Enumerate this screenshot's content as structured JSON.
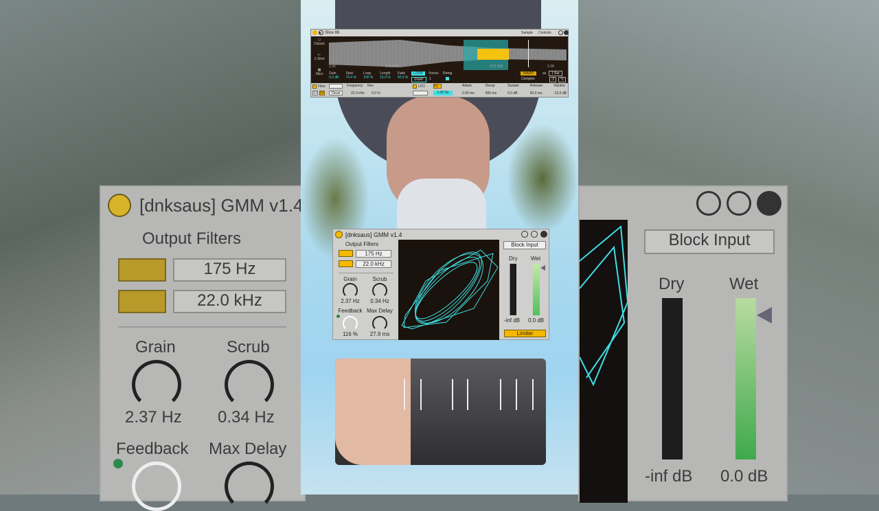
{
  "sampler": {
    "title": "Slice 86",
    "tabs": [
      "Sample",
      "Controls"
    ],
    "modes": [
      "Classic",
      "1-Shot",
      "Slice"
    ],
    "time_labels": [
      "2:36",
      "2:36.500",
      "2:37",
      "2:37.500",
      "2:38"
    ],
    "params": [
      {
        "label": "Gain",
        "value": "0.0 dB"
      },
      {
        "label": "Start",
        "value": "74.4 %"
      },
      {
        "label": "Loop",
        "value": "100 %"
      },
      {
        "label": "Length",
        "value": "15.9 %"
      },
      {
        "label": "Fade",
        "value": "50.0 %"
      }
    ],
    "loop_label": "LOOP",
    "snap_label": "SNAP",
    "voices_label": "Voices",
    "voices_value": "1",
    "retrig_label": "Retrig",
    "warp_label": "WARP",
    "as_label": "as",
    "bar_value": "1 Bar",
    "warp_mode": "Complex",
    "half_label": ":2",
    "double_label": "*2",
    "filter_label": "Filter",
    "filter_type": "",
    "filter_12": "12",
    "filter_24": "24",
    "filter_circuit": "Clean",
    "frequency_label": "Frequency",
    "frequency_value": "22.0 kHz",
    "res_label": "Res",
    "res_value": "0.0 %",
    "lfo_label": "LFO",
    "lfo_hz": "Hz",
    "lfo_rate": "1.00 Hz",
    "envelope": [
      {
        "label": "Attack",
        "value": "0.00 ms"
      },
      {
        "label": "Decay",
        "value": "600 ms"
      },
      {
        "label": "Sustain",
        "value": "0.0 dB"
      },
      {
        "label": "Release",
        "value": "50.0 ms"
      },
      {
        "label": "Volume",
        "value": "-12.0 dB"
      }
    ]
  },
  "gmm": {
    "title": "[dnksaus] GMM v1.4",
    "output_filters": "Output Filters",
    "hp_value": "175 Hz",
    "lp_value": "22.0 kHz",
    "grain_label": "Grain",
    "grain_value": "2.37 Hz",
    "scrub_label": "Scrub",
    "scrub_value": "0.34 Hz",
    "feedback_label": "Feedback",
    "feedback_value": "116 %",
    "max_delay_label": "Max Delay",
    "max_delay_value": "27.9 ms",
    "block_input": "Block Input",
    "dry_label": "Dry",
    "dry_value": "-inf dB",
    "wet_label": "Wet",
    "wet_value": "0.0 dB",
    "wet_level": 0.95,
    "limiter": "Limiter",
    "scope_color": "#3fe0e6",
    "accent": "#f5b800"
  }
}
